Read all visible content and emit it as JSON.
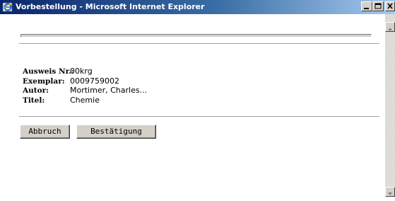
{
  "window": {
    "title": "Vorbestellung - Microsoft Internet Explorer",
    "icon": "ie-icon",
    "controls": [
      "minimize-icon",
      "maximize-icon",
      "close-icon"
    ]
  },
  "details": {
    "rows": [
      {
        "label": "Ausweis Nr.:",
        "value": "00krg"
      },
      {
        "label": "Exemplar:",
        "value": "0009759002"
      },
      {
        "label": "Autor:",
        "value": "Mortimer, Charles..."
      },
      {
        "label": "Titel:",
        "value": "Chemie"
      }
    ]
  },
  "buttons": {
    "cancel_label": "Abbruch",
    "confirm_label": "Bestätigung"
  },
  "colors": {
    "titlebar_start": "#0a246a",
    "titlebar_end": "#a6caf0",
    "button_face": "#d4d0c8"
  }
}
